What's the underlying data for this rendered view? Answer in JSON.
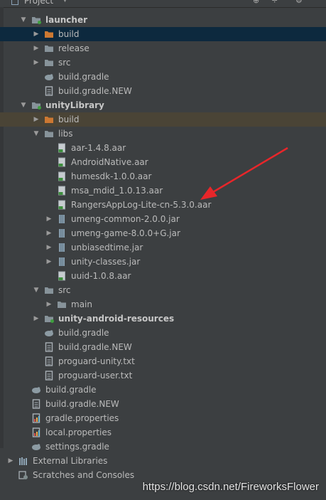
{
  "panel": {
    "title": "Project"
  },
  "tree": [
    {
      "label": "launcher",
      "depth": 0,
      "arrow": "down",
      "icon": "module-folder-icon",
      "bold": true
    },
    {
      "label": "build",
      "depth": 1,
      "arrow": "right",
      "icon": "excluded-folder-icon",
      "selected": true
    },
    {
      "label": "release",
      "depth": 1,
      "arrow": "right",
      "icon": "folder-icon"
    },
    {
      "label": "src",
      "depth": 1,
      "arrow": "right",
      "icon": "folder-icon"
    },
    {
      "label": "build.gradle",
      "depth": 1,
      "arrow": "none",
      "icon": "gradle-icon"
    },
    {
      "label": "build.gradle.NEW",
      "depth": 1,
      "arrow": "none",
      "icon": "file-icon"
    },
    {
      "label": "unityLibrary",
      "depth": 0,
      "arrow": "down",
      "icon": "module-folder-icon",
      "bold": true
    },
    {
      "label": "build",
      "depth": 1,
      "arrow": "right",
      "icon": "excluded-folder-icon",
      "excluded": true
    },
    {
      "label": "libs",
      "depth": 1,
      "arrow": "down",
      "icon": "folder-icon"
    },
    {
      "label": "aar-1.4.8.aar",
      "depth": 2,
      "arrow": "none",
      "icon": "aar-icon"
    },
    {
      "label": "AndroidNative.aar",
      "depth": 2,
      "arrow": "none",
      "icon": "aar-icon"
    },
    {
      "label": "humesdk-1.0.0.aar",
      "depth": 2,
      "arrow": "none",
      "icon": "aar-icon"
    },
    {
      "label": "msa_mdid_1.0.13.aar",
      "depth": 2,
      "arrow": "none",
      "icon": "aar-icon"
    },
    {
      "label": "RangersAppLog-Lite-cn-5.3.0.aar",
      "depth": 2,
      "arrow": "none",
      "icon": "aar-icon"
    },
    {
      "label": "umeng-common-2.0.0.jar",
      "depth": 2,
      "arrow": "right",
      "icon": "jar-icon"
    },
    {
      "label": "umeng-game-8.0.0+G.jar",
      "depth": 2,
      "arrow": "right",
      "icon": "jar-icon"
    },
    {
      "label": "unbiasedtime.jar",
      "depth": 2,
      "arrow": "right",
      "icon": "jar-icon"
    },
    {
      "label": "unity-classes.jar",
      "depth": 2,
      "arrow": "right",
      "icon": "jar-icon"
    },
    {
      "label": "uuid-1.0.8.aar",
      "depth": 2,
      "arrow": "none",
      "icon": "aar-icon"
    },
    {
      "label": "src",
      "depth": 1,
      "arrow": "down",
      "icon": "folder-icon"
    },
    {
      "label": "main",
      "depth": 2,
      "arrow": "right",
      "icon": "folder-icon"
    },
    {
      "label": "unity-android-resources",
      "depth": 1,
      "arrow": "right",
      "icon": "module-folder-icon",
      "bold": true
    },
    {
      "label": "build.gradle",
      "depth": 1,
      "arrow": "none",
      "icon": "gradle-icon"
    },
    {
      "label": "build.gradle.NEW",
      "depth": 1,
      "arrow": "none",
      "icon": "file-icon"
    },
    {
      "label": "proguard-unity.txt",
      "depth": 1,
      "arrow": "none",
      "icon": "text-file-icon"
    },
    {
      "label": "proguard-user.txt",
      "depth": 1,
      "arrow": "none",
      "icon": "text-file-icon"
    },
    {
      "label": "build.gradle",
      "depth": 0,
      "arrow": "none",
      "icon": "gradle-icon"
    },
    {
      "label": "build.gradle.NEW",
      "depth": 0,
      "arrow": "none",
      "icon": "file-icon"
    },
    {
      "label": "gradle.properties",
      "depth": 0,
      "arrow": "none",
      "icon": "properties-icon"
    },
    {
      "label": "local.properties",
      "depth": 0,
      "arrow": "none",
      "icon": "properties-icon"
    },
    {
      "label": "settings.gradle",
      "depth": 0,
      "arrow": "none",
      "icon": "gradle-icon"
    },
    {
      "label": "External Libraries",
      "depth": -1,
      "arrow": "right",
      "icon": "library-icon"
    },
    {
      "label": "Scratches and Consoles",
      "depth": -1,
      "arrow": "none",
      "icon": "scratches-icon"
    }
  ],
  "watermark": "https://blog.csdn.net/FireworksFlower",
  "colors": {
    "background": "#3c3f41",
    "selected": "#0d293e",
    "excluded": "#4a4436",
    "folder": "#87939a",
    "excluded_folder": "#cc7832",
    "arrow_annotation": "#e8262a"
  }
}
